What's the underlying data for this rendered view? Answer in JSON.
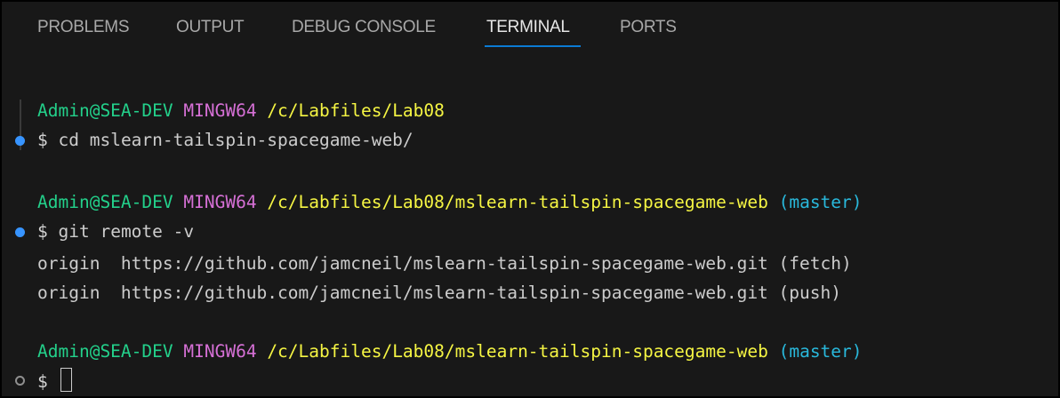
{
  "tabs": [
    {
      "label": "PROBLEMS"
    },
    {
      "label": "OUTPUT"
    },
    {
      "label": "DEBUG CONSOLE"
    },
    {
      "label": "TERMINAL",
      "active": true
    },
    {
      "label": "PORTS"
    }
  ],
  "terminal": {
    "prompt1": {
      "user": "Admin@SEA-DEV",
      "system": "MINGW64",
      "path": "/c/Labfiles/Lab08"
    },
    "cmd1": {
      "symbol": "$",
      "text": "cd mslearn-tailspin-spacegame-web/"
    },
    "prompt2": {
      "user": "Admin@SEA-DEV",
      "system": "MINGW64",
      "path": "/c/Labfiles/Lab08/mslearn-tailspin-spacegame-web",
      "branch": "(master)"
    },
    "cmd2": {
      "symbol": "$",
      "text": "git remote -v"
    },
    "output": [
      "origin  https://github.com/jamcneil/mslearn-tailspin-spacegame-web.git (fetch)",
      "origin  https://github.com/jamcneil/mslearn-tailspin-spacegame-web.git (push)"
    ],
    "prompt3": {
      "user": "Admin@SEA-DEV",
      "system": "MINGW64",
      "path": "/c/Labfiles/Lab08/mslearn-tailspin-spacegame-web",
      "branch": "(master)"
    },
    "cmd3": {
      "symbol": "$",
      "text": ""
    }
  },
  "colors": {
    "user": "#23d18b",
    "system": "#d670d6",
    "path": "#f5f543",
    "branch": "#29b8db",
    "accent": "#0b7bd4",
    "background": "#181818"
  },
  "icons": {
    "decoration_success": "filled-circle-icon",
    "decoration_idle": "hollow-circle-icon"
  }
}
